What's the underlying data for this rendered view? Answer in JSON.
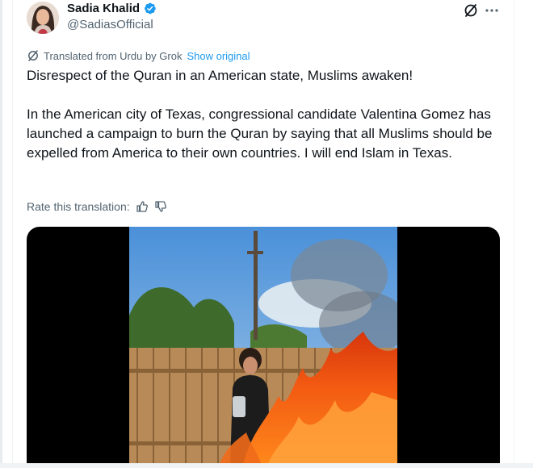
{
  "author": {
    "display_name": "Sadia Khalid",
    "handle": "@SadiasOfficial",
    "verified_icon": "verified-badge-icon",
    "avatar_icon": "avatar"
  },
  "header_actions": {
    "grok_icon": "grok-icon",
    "more_icon": "more-icon"
  },
  "translation": {
    "label": "Translated from Urdu by Grok",
    "show_original": "Show original"
  },
  "tweet": {
    "paragraph_1": "Disrespect of the Quran in an American state, Muslims awaken!",
    "paragraph_2": "In the American city of Texas, congressional candidate Valentina Gomez has launched a campaign to burn the Quran by saying that all Muslims should be expelled from America to their own countries. I will end Islam in Texas."
  },
  "rate": {
    "label": "Rate this translation:",
    "thumbs_up_icon": "thumbs-up-icon",
    "thumbs_down_icon": "thumbs-down-icon"
  },
  "colors": {
    "text": "#0f1419",
    "secondary": "#536471",
    "link": "#1d9bf0",
    "verified": "#1d9bf0"
  }
}
